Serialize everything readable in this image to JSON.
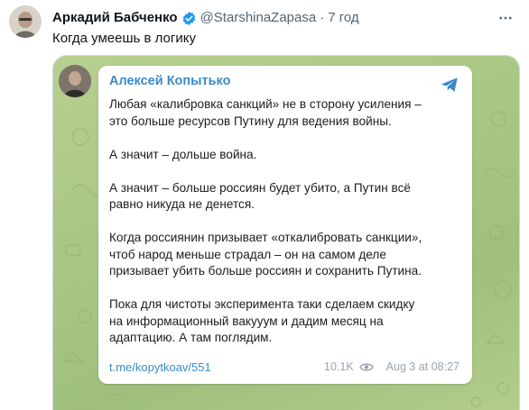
{
  "tweet": {
    "author_name": "Аркадий Бабченко",
    "handle": "@StarshinaZapasa",
    "separator": "·",
    "time": "7 год",
    "text": "Когда умеешь в логику"
  },
  "telegram_post": {
    "channel_name": "Алексей Копытько",
    "paragraphs": [
      [
        "Любая «калибровка санкций» не в сторону усиления –",
        "это больше ресурсов Путину для ведения войны."
      ],
      [
        "А значит – дольше война."
      ],
      [
        "А значит – больше россиян будет убито, а Путин всё",
        "равно никуда не денется."
      ],
      [
        "Когда россиянин призывает «откалибровать санкции»,",
        "чтоб народ меньше страдал – он на самом деле",
        "призывает убить больше россиян и сохранить Путина."
      ],
      [
        "Пока для чистоты эксперимента таки сделаем скидку",
        "на информационный вакууум и дадим месяц на",
        "адаптацию. А там поглядим."
      ]
    ],
    "link": "t.me/kopytkoav/551",
    "views": "10.1K",
    "date": "Aug 3 at 08:27"
  },
  "colors": {
    "verified": "#1d9bf0",
    "telegram_blue": "#3a8bc9",
    "chat_background": "#a9c684"
  },
  "icons": [
    "verified-badge-icon",
    "more-options-icon",
    "telegram-plane-icon",
    "views-eye-icon"
  ]
}
